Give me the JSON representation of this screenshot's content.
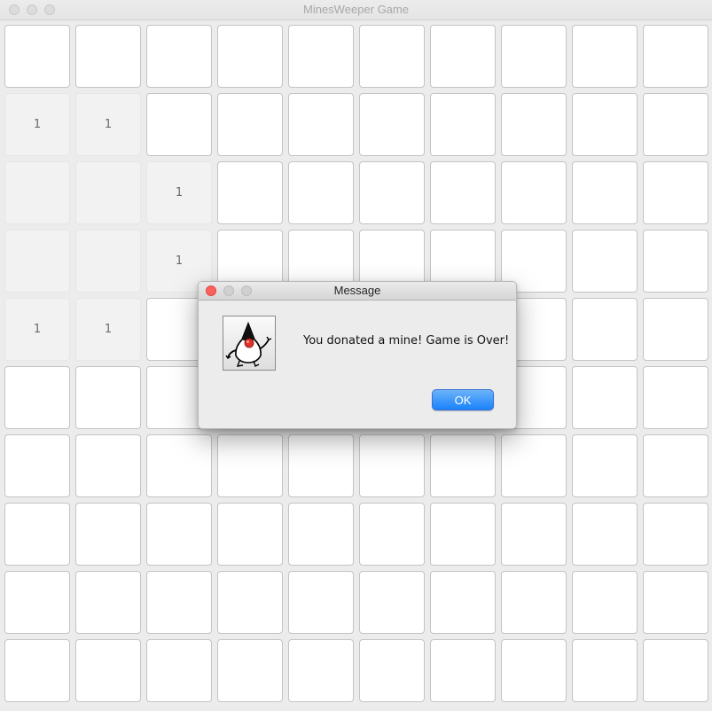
{
  "window": {
    "title": "MinesWeeper Game"
  },
  "board": {
    "rows": [
      [
        "",
        "",
        "",
        "",
        "",
        "",
        "",
        "",
        "",
        ""
      ],
      [
        "1",
        "1",
        "",
        "",
        "",
        "",
        "",
        "",
        "",
        ""
      ],
      [
        "",
        "",
        "1",
        "",
        "",
        "",
        "",
        "",
        "",
        ""
      ],
      [
        "",
        "",
        "1",
        "",
        "",
        "",
        "",
        "",
        "",
        ""
      ],
      [
        "1",
        "1",
        "",
        "",
        "",
        "",
        "",
        "",
        "",
        ""
      ],
      [
        "",
        "",
        "",
        "",
        "",
        "",
        "",
        "",
        "",
        ""
      ],
      [
        "",
        "",
        "",
        "",
        "",
        "",
        "",
        "",
        "",
        ""
      ],
      [
        "",
        "",
        "",
        "",
        "",
        "",
        "",
        "",
        "",
        ""
      ],
      [
        "",
        "",
        "",
        "",
        "",
        "",
        "",
        "",
        "",
        ""
      ],
      [
        "",
        "",
        "",
        "",
        "",
        "",
        "",
        "",
        "",
        ""
      ]
    ],
    "revealed": [
      [
        false,
        false,
        false,
        false,
        false,
        false,
        false,
        false,
        false,
        false
      ],
      [
        true,
        true,
        false,
        false,
        false,
        false,
        false,
        false,
        false,
        false
      ],
      [
        true,
        true,
        true,
        false,
        false,
        false,
        false,
        false,
        false,
        false
      ],
      [
        true,
        true,
        true,
        false,
        false,
        false,
        false,
        false,
        false,
        false
      ],
      [
        true,
        true,
        false,
        false,
        false,
        false,
        false,
        false,
        false,
        false
      ],
      [
        false,
        false,
        false,
        false,
        false,
        false,
        false,
        false,
        false,
        false
      ],
      [
        false,
        false,
        false,
        false,
        false,
        false,
        false,
        false,
        false,
        false
      ],
      [
        false,
        false,
        false,
        false,
        false,
        false,
        false,
        false,
        false,
        false
      ],
      [
        false,
        false,
        false,
        false,
        false,
        false,
        false,
        false,
        false,
        false
      ],
      [
        false,
        false,
        false,
        false,
        false,
        false,
        false,
        false,
        false,
        false
      ]
    ]
  },
  "dialog": {
    "title": "Message",
    "message": "You donated a mine! Game is Over!",
    "ok_label": "OK",
    "icon": "java-duke-icon"
  },
  "colors": {
    "ok_button": "#1a82fb",
    "close_button": "#fc605c"
  }
}
